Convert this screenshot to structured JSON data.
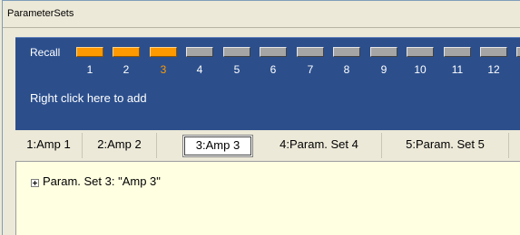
{
  "panel": {
    "title": "ParameterSets"
  },
  "recall": {
    "label": "Recall",
    "current": "3",
    "slots": [
      {
        "number": "1",
        "state": "active"
      },
      {
        "number": "2",
        "state": "active"
      },
      {
        "number": "3",
        "state": "active"
      },
      {
        "number": "4",
        "state": "inactive"
      },
      {
        "number": "5",
        "state": "inactive"
      },
      {
        "number": "6",
        "state": "inactive"
      },
      {
        "number": "7",
        "state": "inactive"
      },
      {
        "number": "8",
        "state": "inactive"
      },
      {
        "number": "9",
        "state": "inactive"
      },
      {
        "number": "10",
        "state": "inactive"
      },
      {
        "number": "11",
        "state": "inactive"
      },
      {
        "number": "12",
        "state": "inactive"
      }
    ],
    "hint": "Right click here to add"
  },
  "tabs": [
    {
      "label": "1:Amp 1"
    },
    {
      "label": "2:Amp 2"
    },
    {
      "label": "3:Amp 3"
    },
    {
      "label": "4:Param. Set 4"
    },
    {
      "label": "5:Param. Set 5"
    }
  ],
  "active_tab": "3:Amp 3",
  "tree": {
    "item": "Param. Set 3: \"Amp 3\""
  },
  "colors": {
    "panel_bg": "#ece9d8",
    "recall_bg": "#2c4f8c",
    "active_slot": "#ff9900",
    "inactive_slot": "#a5a5a5",
    "tree_bg": "#ffffe1"
  }
}
